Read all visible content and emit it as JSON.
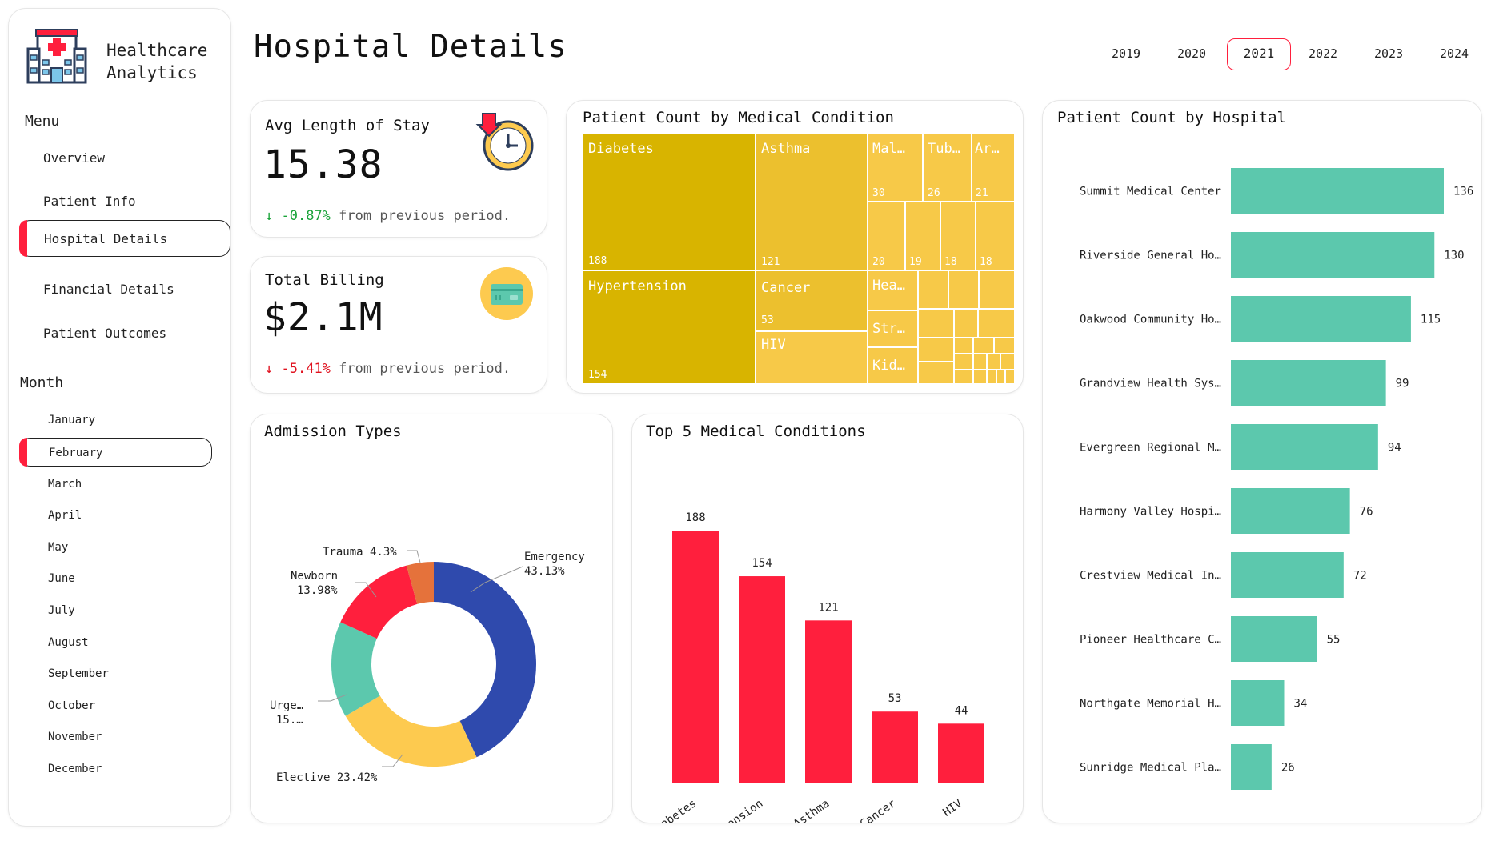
{
  "app": {
    "brand_line1": "Healthcare",
    "brand_line2": "Analytics",
    "page_title": "Hospital Details"
  },
  "menu": {
    "heading": "Menu",
    "items": [
      {
        "label": "Overview",
        "active": false
      },
      {
        "label": "Patient Info",
        "active": false
      },
      {
        "label": "Hospital Details",
        "active": true
      },
      {
        "label": "Financial Details",
        "active": false
      },
      {
        "label": "Patient Outcomes",
        "active": false
      }
    ]
  },
  "month": {
    "heading": "Month",
    "items": [
      "January",
      "February",
      "March",
      "April",
      "May",
      "June",
      "July",
      "August",
      "September",
      "October",
      "November",
      "December"
    ],
    "selected": "February"
  },
  "years": {
    "items": [
      "2019",
      "2020",
      "2021",
      "2022",
      "2023",
      "2024"
    ],
    "selected": "2021"
  },
  "kpis": {
    "avg_stay": {
      "label": "Avg Length of Stay",
      "value": "15.38",
      "delta_arrow": "↓",
      "delta": "-0.87%",
      "suffix": "from previous period."
    },
    "billing": {
      "label": "Total Billing",
      "value": "$2.1M",
      "delta_arrow": "↓",
      "delta": "-5.41%",
      "suffix": "from previous period."
    }
  },
  "colors": {
    "accent": "#ff1f3d",
    "teal": "#5cc8ad",
    "gold_dark": "#d8b400",
    "gold": "#ecc02e",
    "gold_light": "#f7c948",
    "navy": "#2f4aad",
    "orange": "#e5723b",
    "yellow": "#fdca4f"
  },
  "icons": {
    "stay": "stopwatch-icon",
    "billing": "credit-card-icon",
    "brand": "hospital-building-icon"
  },
  "treemap": {
    "title": "Patient Count by Medical Condition",
    "cells": [
      {
        "label": "Diabetes",
        "value": "188"
      },
      {
        "label": "Asthma",
        "value": "121"
      },
      {
        "label": "Hypertension",
        "value": "154"
      },
      {
        "label": "Cancer",
        "value": "53"
      },
      {
        "label": "HIV",
        "value": ""
      },
      {
        "label": "Mal…",
        "value": "30"
      },
      {
        "label": "Tub…",
        "value": "26"
      },
      {
        "label": "Ar…",
        "value": "21"
      },
      {
        "label": "",
        "value": "20"
      },
      {
        "label": "",
        "value": "19"
      },
      {
        "label": "",
        "value": "18"
      },
      {
        "label": "",
        "value": "18"
      },
      {
        "label": "Hea…",
        "value": ""
      },
      {
        "label": "Str…",
        "value": ""
      },
      {
        "label": "Kid…",
        "value": ""
      }
    ]
  },
  "chart_data": [
    {
      "type": "pie",
      "title": "Admission Types",
      "donut": true,
      "slices": [
        {
          "name": "Emergency",
          "value": 43.13,
          "label": "43.13%",
          "color": "#2f4aad"
        },
        {
          "name": "Elective",
          "value": 23.42,
          "label": "23.42%",
          "color": "#fdca4f"
        },
        {
          "name": "Urge…",
          "value": 15.17,
          "label": "15.…",
          "color": "#5cc8ad"
        },
        {
          "name": "Newborn",
          "value": 13.98,
          "label": "13.98%",
          "color": "#ff1f3d"
        },
        {
          "name": "Trauma",
          "value": 4.3,
          "label": "4.3%",
          "color": "#e5723b"
        }
      ]
    },
    {
      "type": "bar",
      "title": "Top 5 Medical Conditions",
      "categories": [
        "Diabetes",
        "Hypertension",
        "Asthma",
        "Cancer",
        "HIV"
      ],
      "values": [
        188,
        154,
        121,
        53,
        44
      ],
      "color": "#ff1f3d",
      "ylim": [
        0,
        200
      ]
    },
    {
      "type": "bar",
      "orientation": "horizontal",
      "title": "Patient Count by Hospital",
      "categories": [
        "Summit Medical Center",
        "Riverside General Ho…",
        "Oakwood Community Ho…",
        "Grandview Health Sys…",
        "Evergreen Regional M…",
        "Harmony Valley Hospi…",
        "Crestview Medical In…",
        "Pioneer Healthcare C…",
        "Northgate Memorial H…",
        "Sunridge Medical Pla…"
      ],
      "values": [
        136,
        130,
        115,
        99,
        94,
        76,
        72,
        55,
        34,
        26
      ],
      "color": "#5cc8ad",
      "xlim": [
        0,
        136
      ]
    }
  ]
}
